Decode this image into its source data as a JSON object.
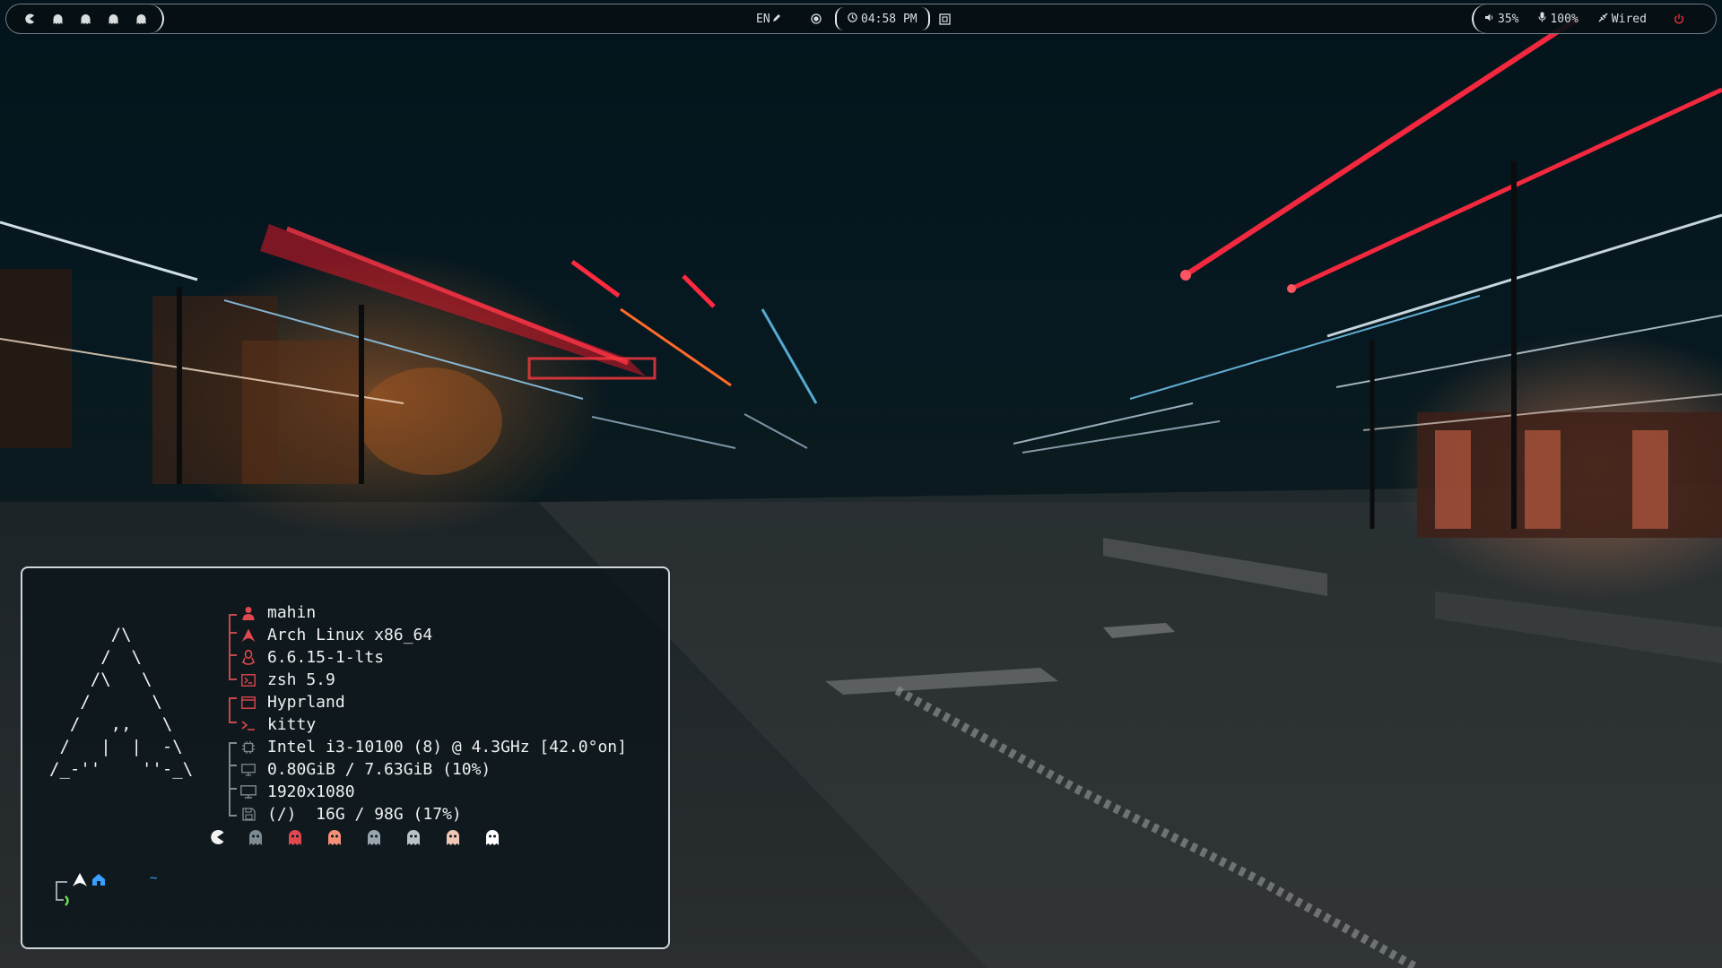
{
  "topbar": {
    "workspaces": [
      {
        "icon": "pacman-icon",
        "color": "#d8dde0"
      },
      {
        "icon": "ghost-icon",
        "color": "#d8dde0"
      },
      {
        "icon": "ghost-icon",
        "color": "#d8dde0"
      },
      {
        "icon": "ghost-icon",
        "color": "#d8dde0"
      },
      {
        "icon": "ghost-icon",
        "color": "#d8dde0"
      }
    ],
    "language": "EN",
    "clock": "04:58 PM",
    "volume": "35%",
    "microphone": "100%",
    "network": "Wired",
    "power_color": "#e0303a"
  },
  "terminal": {
    "ascii_logo": "      /\\\n     /  \\\n    /\\   \\\n   /      \\\n  /   ,,   \\\n /   |  |  -\\\n/_-''    ''-_\\",
    "info": [
      {
        "icon": "user-icon",
        "text": "mahin"
      },
      {
        "icon": "arch-icon",
        "text": "Arch Linux x86_64"
      },
      {
        "icon": "linux-icon",
        "text": "6.6.15-1-lts"
      },
      {
        "icon": "shell-icon",
        "text": "zsh 5.9"
      },
      {
        "icon": "window-icon",
        "text": "Hyprland"
      },
      {
        "icon": "terminal-icon",
        "text": "kitty"
      },
      {
        "icon": "cpu-icon",
        "text": "Intel i3-10100 (8) @ 4.3GHz [42.0°on]"
      },
      {
        "icon": "memory-icon",
        "text": "0.80GiB / 7.63GiB (10%)"
      },
      {
        "icon": "monitor-icon",
        "text": "1920x1080"
      },
      {
        "icon": "disk-icon",
        "text": "(/)  16G / 98G (17%)"
      }
    ],
    "palette": [
      {
        "icon": "pacman-icon",
        "color": "#f2f2f2"
      },
      {
        "icon": "ghost-icon",
        "color": "#7d8a92"
      },
      {
        "icon": "ghost-icon",
        "color": "#e0484f"
      },
      {
        "icon": "ghost-icon",
        "color": "#f29078"
      },
      {
        "icon": "ghost-icon",
        "color": "#9aa6ad"
      },
      {
        "icon": "ghost-icon",
        "color": "#b9c2c7"
      },
      {
        "icon": "ghost-icon",
        "color": "#f0c6b6"
      },
      {
        "icon": "ghost-icon",
        "color": "#ffffff"
      }
    ],
    "prompt": {
      "dir": "~",
      "colors": {
        "arch": "#ffffff",
        "home": "#3aa0ff",
        "dir": "#3aa0ff",
        "arrow": "#6ee04a"
      }
    },
    "accent": "#e0484f"
  }
}
